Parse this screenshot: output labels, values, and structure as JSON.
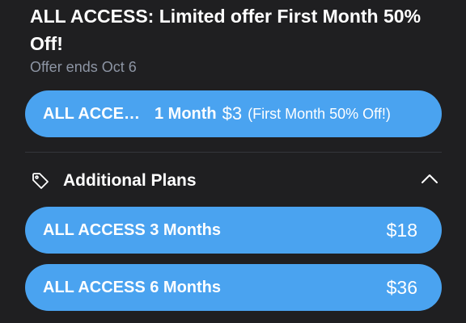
{
  "offer": {
    "title": "ALL ACCESS: Limited offer First Month 50% Off!",
    "ends": "Offer ends Oct 6"
  },
  "main_plan": {
    "name": "ALL ACCE…",
    "duration": "1 Month",
    "price": "$3",
    "note": "(First Month 50% Off!)"
  },
  "additional": {
    "title": "Additional Plans",
    "tag_icon": "tag-icon",
    "toggle_icon": "chevron-up-icon"
  },
  "plans": [
    {
      "name": "ALL ACCESS 3 Months",
      "price": "$18"
    },
    {
      "name": "ALL ACCESS 6 Months",
      "price": "$36"
    }
  ],
  "colors": {
    "background": "#1f1f21",
    "accent": "#4aa3f0",
    "muted_text": "#8d95a4"
  }
}
